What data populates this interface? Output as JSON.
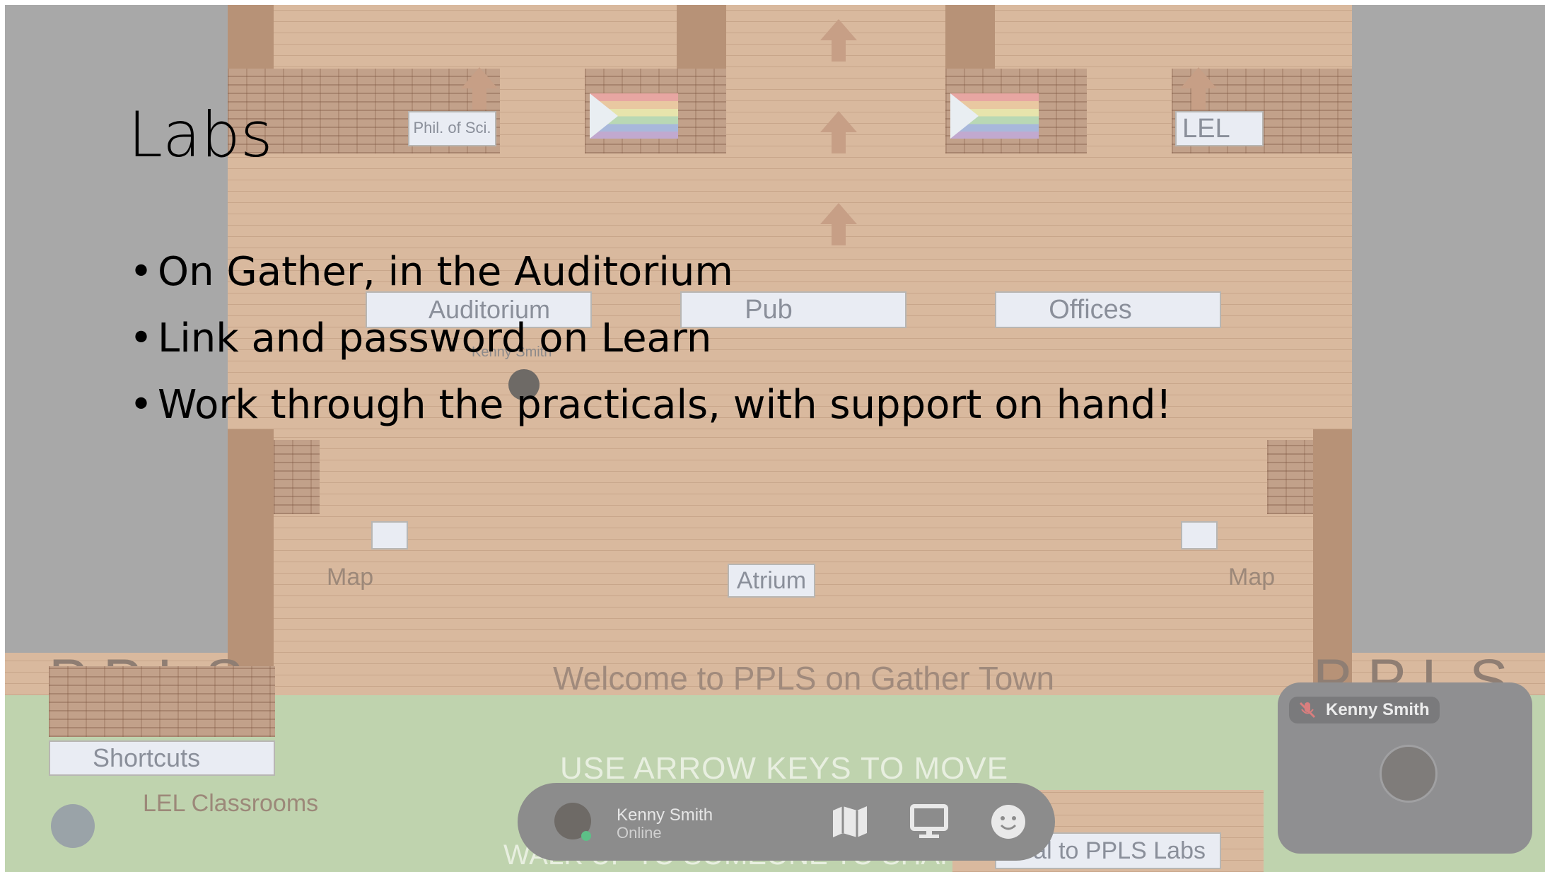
{
  "slide": {
    "title": "Labs",
    "bullets": [
      "On Gather, in the Auditorium",
      "Link and password on Learn",
      "Work through the practicals, with support on hand!"
    ]
  },
  "map": {
    "signs": {
      "phil_of_sci": "Phil. of Sci.",
      "lel": "LEL",
      "auditorium": "Auditorium",
      "pub": "Pub",
      "offices": "Offices",
      "atrium": "Atrium",
      "shortcuts": "Shortcuts",
      "portal_labs": "al to PPLS Labs"
    },
    "map_label_left": "Map",
    "map_label_right": "Map",
    "player_name": "Kenny Smith",
    "welcome_text": "Welcome to PPLS on Gather Town",
    "pps_left": "PPLS",
    "pps_right": "PPLS",
    "lel_classrooms": "LEL Classrooms",
    "instruction_move": "USE ARROW KEYS TO MOVE",
    "instruction_video": "WALK UP TO SOMEONE TO SHARE VIDEO"
  },
  "toolbar": {
    "user_name": "Kenny Smith",
    "user_status": "Online",
    "icons": [
      "map-icon",
      "screen-share-icon",
      "emoji-icon"
    ]
  },
  "video_tile": {
    "name": "Kenny Smith",
    "mic_state": "muted"
  },
  "colors": {
    "overlay_grey": "#a8a8a8",
    "wood_floor": "#d9b99e",
    "grass": "#bfd3ae",
    "online": "#5dbf87",
    "toolbar_bg": "#8c8c8c"
  }
}
